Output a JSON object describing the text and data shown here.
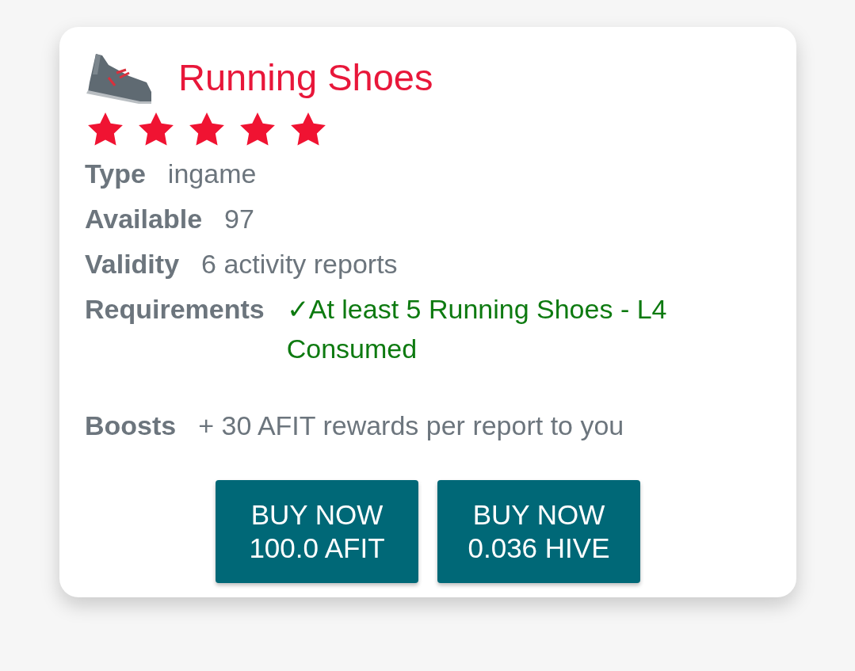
{
  "item": {
    "title": "Running Shoes",
    "stars": 5
  },
  "details": [
    {
      "label": "Type",
      "value": "ingame",
      "kind": "plain"
    },
    {
      "label": "Available",
      "value": "97",
      "kind": "plain"
    },
    {
      "label": "Validity",
      "value": "6 activity reports",
      "kind": "plain"
    },
    {
      "label": "Requirements",
      "value": "✓At least 5 Running Shoes - L4 Consumed",
      "kind": "requirement",
      "met": true
    }
  ],
  "boosts": {
    "label": "Boosts",
    "value": "+ 30 AFIT rewards per report to you"
  },
  "buttons": [
    {
      "line1": "BUY NOW",
      "line2": "100.0 AFIT"
    },
    {
      "line1": "BUY NOW",
      "line2": "0.036 HIVE"
    }
  ]
}
